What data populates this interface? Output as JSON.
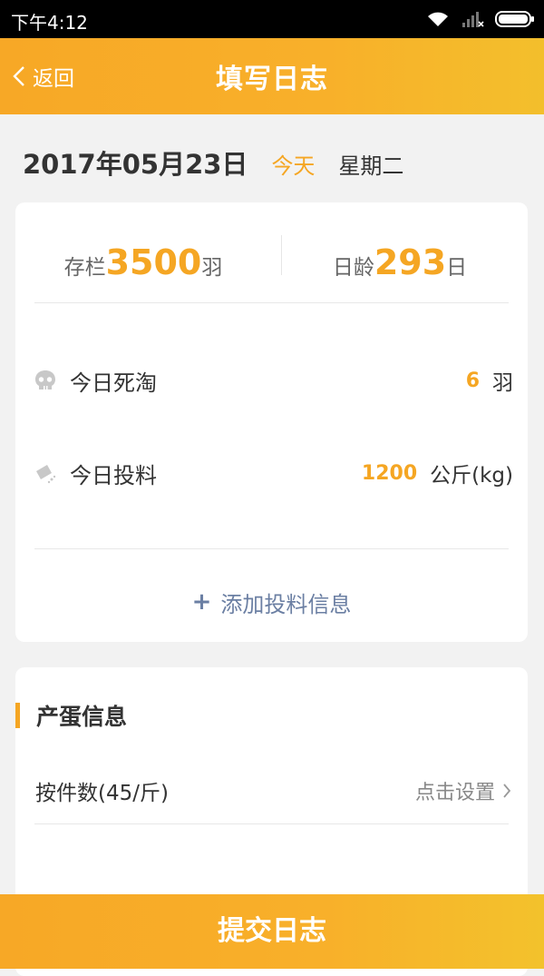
{
  "status_bar": {
    "time": "下午4:12"
  },
  "nav": {
    "back_label": "返回",
    "title": "填写日志"
  },
  "date": {
    "date_text": "2017年05月23日",
    "today_label": "今天",
    "weekday": "星期二"
  },
  "stats": {
    "stock_label": "存栏",
    "stock_value": "3500",
    "stock_unit": "羽",
    "age_label": "日龄",
    "age_value": "293",
    "age_unit": "日"
  },
  "daily": {
    "death_label": "今日死淘",
    "death_value": "6",
    "death_unit": "羽",
    "feed_label": "今日投料",
    "feed_value": "1200",
    "feed_unit": "公斤(kg)"
  },
  "add_feed_label": "添加投料信息",
  "egg_section": {
    "title": "产蛋信息",
    "pieces_label": "按件数(45/斤)",
    "set_action": "点击设置"
  },
  "submit_label": "提交日志",
  "colors": {
    "accent": "#f5a623",
    "link": "#6b7fa3"
  }
}
